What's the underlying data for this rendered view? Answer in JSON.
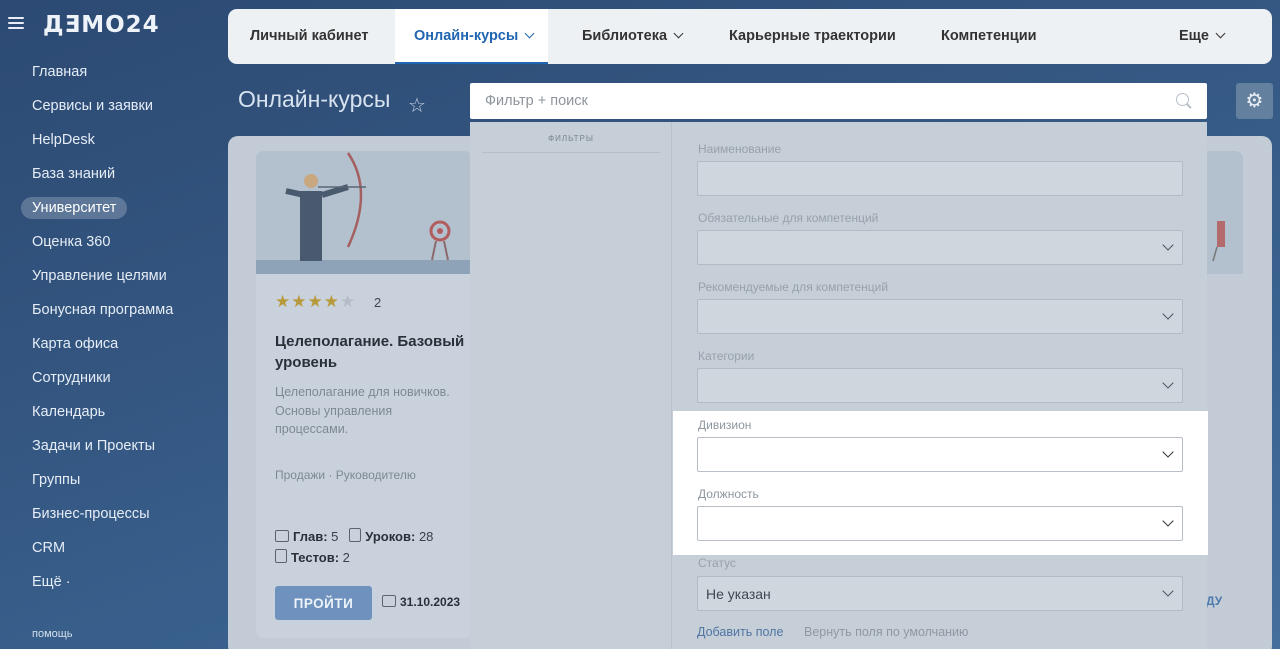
{
  "logo": "ДƎМО24",
  "sidebar": {
    "items": [
      {
        "label": "Главная"
      },
      {
        "label": "Сервисы и заявки"
      },
      {
        "label": "HelpDesk"
      },
      {
        "label": "База знаний"
      },
      {
        "label": "Университет",
        "active": true
      },
      {
        "label": "Оценка 360"
      },
      {
        "label": "Управление целями"
      },
      {
        "label": "Бонусная программа"
      },
      {
        "label": "Карта офиса"
      },
      {
        "label": "Сотрудники"
      },
      {
        "label": "Календарь"
      },
      {
        "label": "Задачи и Проекты"
      },
      {
        "label": "Группы"
      },
      {
        "label": "Бизнес-процессы"
      },
      {
        "label": "CRM"
      },
      {
        "label": "Ещё ·"
      }
    ],
    "help": "помощь"
  },
  "tabs": [
    {
      "label": "Личный кабинет"
    },
    {
      "label": "Онлайн-курсы",
      "active": true
    },
    {
      "label": "Библиотека"
    },
    {
      "label": "Карьерные траектории"
    },
    {
      "label": "Компетенции"
    },
    {
      "label": "Еще"
    }
  ],
  "page_title": "Онлайн-курсы",
  "search": {
    "placeholder": "Фильтр + поиск"
  },
  "course_card": {
    "rating": 4,
    "rating_max": 5,
    "rating_count": "2",
    "title": "Целеполагание. Базовый уровень",
    "description": "Целеполагание для новичков. Основы управления процессами.",
    "tags": "Продажи · Руководителю",
    "chapters_label": "Глав:",
    "chapters": "5",
    "lessons_label": "Уроков:",
    "lessons": "28",
    "tests_label": "Тестов:",
    "tests": "2",
    "button": "ПРОЙТИ",
    "date": "31.10.2023"
  },
  "right_card_link": "ДУ",
  "filter": {
    "left_title": "ФИЛЬТРЫ",
    "fields": {
      "name": "Наименование",
      "required_competencies": "Обязательные для компетенций",
      "recommended_competencies": "Рекомендуемые для компетенций",
      "categories": "Категории",
      "division": "Дивизион",
      "position": "Должность",
      "status": "Статус",
      "status_value": "Не указан"
    },
    "add_field": "Добавить поле",
    "reset_fields": "Вернуть поля по умолчанию"
  },
  "colors": {
    "accent": "#2066b0",
    "sidebar_bg": "#2c4a73",
    "highlight": "#ffffff"
  }
}
